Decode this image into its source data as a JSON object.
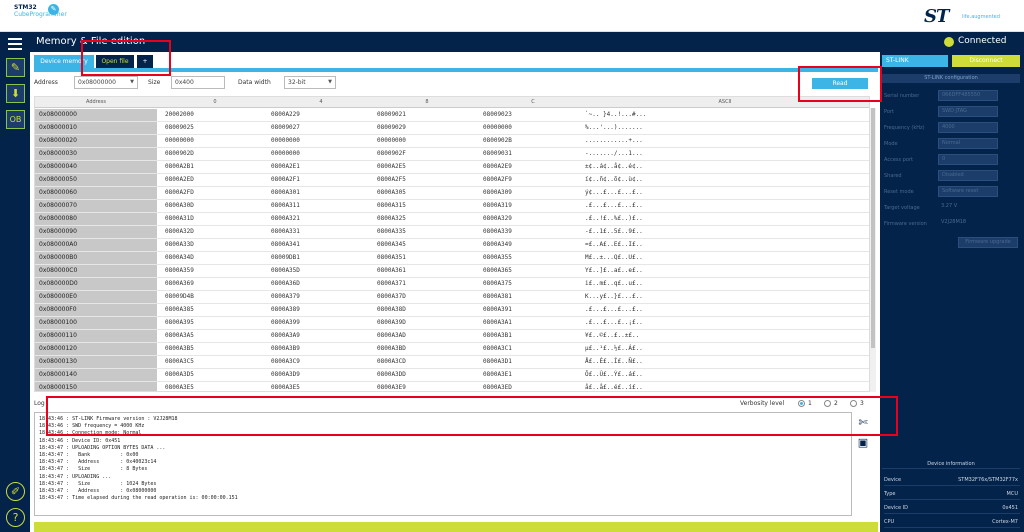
{
  "brand": {
    "left_line1": "STM32",
    "left_line2": "CubeProgrammer",
    "right_mark": "ST",
    "right_tag": "life.augmented"
  },
  "title": "Memory & File edition",
  "connection": {
    "status": "Connected",
    "color": "#cddc39"
  },
  "tabs": [
    {
      "label": "Device memory"
    },
    {
      "label": "Open file"
    },
    {
      "label": "+"
    }
  ],
  "address_bar": {
    "address_label": "Address",
    "address_value": "0x08000000",
    "size_label": "Size",
    "size_value": "0x400",
    "data_width_label": "Data width",
    "data_width_value": "32-bit",
    "read_button": "Read"
  },
  "memory_table": {
    "headers": [
      "Address",
      "0",
      "4",
      "8",
      "C",
      "ASCII"
    ],
    "rows": [
      [
        "0x08000000",
        "20002000",
        "0800A229",
        "08009021",
        "08009023",
        "`~.. }4..!...#..."
      ],
      [
        "0x08000010",
        "08009025",
        "08009027",
        "08009029",
        "00000000",
        "%...'...)......."
      ],
      [
        "0x08000020",
        "00000000",
        "00000000",
        "00000000",
        "0800902B",
        "............+..."
      ],
      [
        "0x08000030",
        "0800902D",
        "00000000",
        "0800902F",
        "08009031",
        "-......./...1..."
      ],
      [
        "0x08000040",
        "0800A2B1",
        "0800A2E1",
        "0800A2E5",
        "0800A2E9",
        "±¢..á¢..å¢..é¢.."
      ],
      [
        "0x08000050",
        "0800A2ED",
        "0800A2F1",
        "0800A2F5",
        "0800A2F9",
        "í¢..ñ¢..õ¢..ù¢.."
      ],
      [
        "0x08000060",
        "0800A2FD",
        "0800A301",
        "0800A305",
        "0800A309",
        "ý¢...£...£...£.."
      ],
      [
        "0x08000070",
        "0800A30D",
        "0800A311",
        "0800A315",
        "0800A319",
        ".£...£...£...£.."
      ],
      [
        "0x08000080",
        "0800A31D",
        "0800A321",
        "0800A325",
        "0800A329",
        ".£..!£..%£..)£.."
      ],
      [
        "0x08000090",
        "0800A32D",
        "0800A331",
        "0800A335",
        "0800A339",
        "-£..1£..5£..9£.."
      ],
      [
        "0x080000A0",
        "0800A33D",
        "0800A341",
        "0800A345",
        "0800A349",
        "=£..A£..E£..I£.."
      ],
      [
        "0x080000B0",
        "0800A34D",
        "08009DB1",
        "0800A351",
        "0800A355",
        "M£..±...Q£..U£.."
      ],
      [
        "0x080000C0",
        "0800A359",
        "0800A35D",
        "0800A361",
        "0800A365",
        "Y£..]£..a£..e£.."
      ],
      [
        "0x080000D0",
        "0800A369",
        "0800A36D",
        "0800A371",
        "0800A375",
        "i£..m£..q£..u£.."
      ],
      [
        "0x080000E0",
        "08009D4B",
        "0800A379",
        "0800A37D",
        "0800A381",
        "K...y£..}£...£.."
      ],
      [
        "0x080000F0",
        "0800A385",
        "0800A389",
        "0800A38D",
        "0800A391",
        ".£...£...£...£.."
      ],
      [
        "0x08000100",
        "0800A395",
        "0800A399",
        "0800A39D",
        "0800A3A1",
        ".£...£...£..¡£.."
      ],
      [
        "0x08000110",
        "0800A3A5",
        "0800A3A9",
        "0800A3AD",
        "0800A3B1",
        "¥£..©£..­£..±£.."
      ],
      [
        "0x08000120",
        "0800A3B5",
        "0800A3B9",
        "0800A3BD",
        "0800A3C1",
        "µ£..¹£..½£..Á£.."
      ],
      [
        "0x08000130",
        "0800A3C5",
        "0800A3C9",
        "0800A3CD",
        "0800A3D1",
        "Å£..É£..Í£..Ñ£.."
      ],
      [
        "0x08000140",
        "0800A3D5",
        "0800A3D9",
        "0800A3DD",
        "0800A3E1",
        "Õ£..Ù£..Ý£..á£.."
      ],
      [
        "0x08000150",
        "0800A3E5",
        "0800A3E5",
        "0800A3E9",
        "0800A3ED",
        "å£..å£..é£..í£.."
      ]
    ]
  },
  "log": {
    "label": "Log",
    "verbosity_label": "Verbosity level",
    "levels": [
      "1",
      "2",
      "3"
    ],
    "lines": [
      "18:43:46 : ST-LINK Firmware version : V2J28M18",
      "18:43:46 : SWD frequency = 4000 KHz",
      "18:43:46 : Connection mode: Normal",
      "18:43:46 : Device ID: 0x451",
      "18:43:47 : UPLOADING OPTION BYTES DATA ...",
      "18:43:47 :   Bank          : 0x00",
      "18:43:47 :   Address       : 0x40023c14",
      "18:43:47 :   Size          : 8 Bytes",
      "18:43:47 : UPLOADING ...",
      "18:43:47 :   Size          : 1024 Bytes",
      "18:43:47 :   Address       : 0x08000000",
      "18:43:47 : Time elapsed during the read operation is: 00:00:00.151"
    ]
  },
  "right_panel": {
    "stlink_tab": "ST-LINK",
    "disconnect_button": "Disconnect",
    "config_header": "ST-LINK configuration",
    "config": [
      {
        "key": "Serial number",
        "value": "066DFF485550"
      },
      {
        "key": "Port",
        "value": "SWD  JTAG"
      },
      {
        "key": "Frequency (kHz)",
        "value": "4000"
      },
      {
        "key": "Mode",
        "value": "Normal"
      },
      {
        "key": "Access port",
        "value": "0"
      },
      {
        "key": "Shared",
        "value": "Disabled"
      },
      {
        "key": "Reset mode",
        "value": "Software reset"
      },
      {
        "key": "Target voltage",
        "value": "3.27 V"
      },
      {
        "key": "Firmware version",
        "value": "V2J28M18"
      }
    ],
    "fw_upgrade_button": "Firmware upgrade",
    "device_info_header": "Device information",
    "device_info": [
      {
        "key": "Device",
        "value": "STM32F76x/STM32F77x"
      },
      {
        "key": "Type",
        "value": "MCU"
      },
      {
        "key": "Device ID",
        "value": "0x451"
      },
      {
        "key": "CPU",
        "value": "Cortex-M7"
      }
    ]
  },
  "colors": {
    "navy": "#03234b",
    "accent_blue": "#3cb4e6",
    "lime": "#cddc39",
    "highlight_red": "#e8001c"
  }
}
